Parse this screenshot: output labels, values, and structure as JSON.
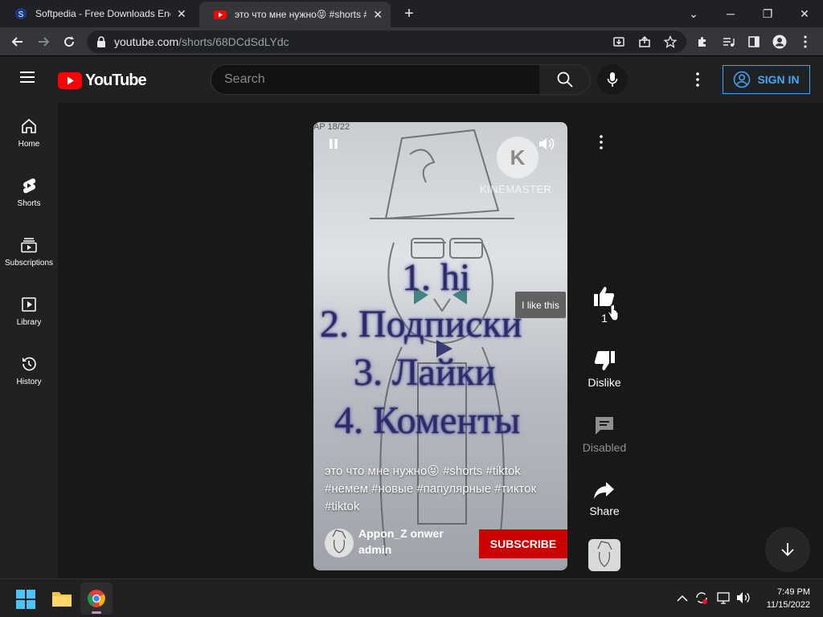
{
  "browser": {
    "tabs": [
      {
        "title": "Softpedia - Free Downloads Ency",
        "active": false
      },
      {
        "title": "это что мне нужно😝 #shorts #",
        "active": true
      }
    ],
    "url_host": "youtube.com",
    "url_path": "/shorts/68DCdSdLYdc"
  },
  "youtube": {
    "logo_text": "YouTube",
    "search_placeholder": "Search",
    "signin_label": "SIGN IN",
    "sidebar": [
      {
        "label": "Home",
        "icon": "home-icon"
      },
      {
        "label": "Shorts",
        "icon": "shorts-icon"
      },
      {
        "label": "Subscriptions",
        "icon": "subscriptions-icon"
      },
      {
        "label": "Library",
        "icon": "library-icon"
      },
      {
        "label": "History",
        "icon": "history-icon"
      }
    ]
  },
  "video": {
    "watermark": "KINEMASTER",
    "corner_text": "AP 18/22",
    "lines": [
      "1. hi",
      "2. Подписки",
      "3. Лайки",
      "4. Коменты"
    ],
    "caption": "это что мне нужно😝 #shorts #tiktok #немем #новые #папулярные #тикток #tiktok",
    "channel_name": "Appon_Z onwer",
    "channel_sub": "admin",
    "subscribe_label": "SUBSCRIBE"
  },
  "actions": {
    "like_count": "1",
    "like_tooltip": "I like this",
    "dislike_label": "Dislike",
    "comments_label": "Disabled",
    "share_label": "Share"
  },
  "taskbar": {
    "time": "7:49 PM",
    "date": "11/15/2022"
  },
  "colors": {
    "accent_blue": "#3ea6ff",
    "subscribe_red": "#cc0000",
    "youtube_red": "#ff0000"
  }
}
